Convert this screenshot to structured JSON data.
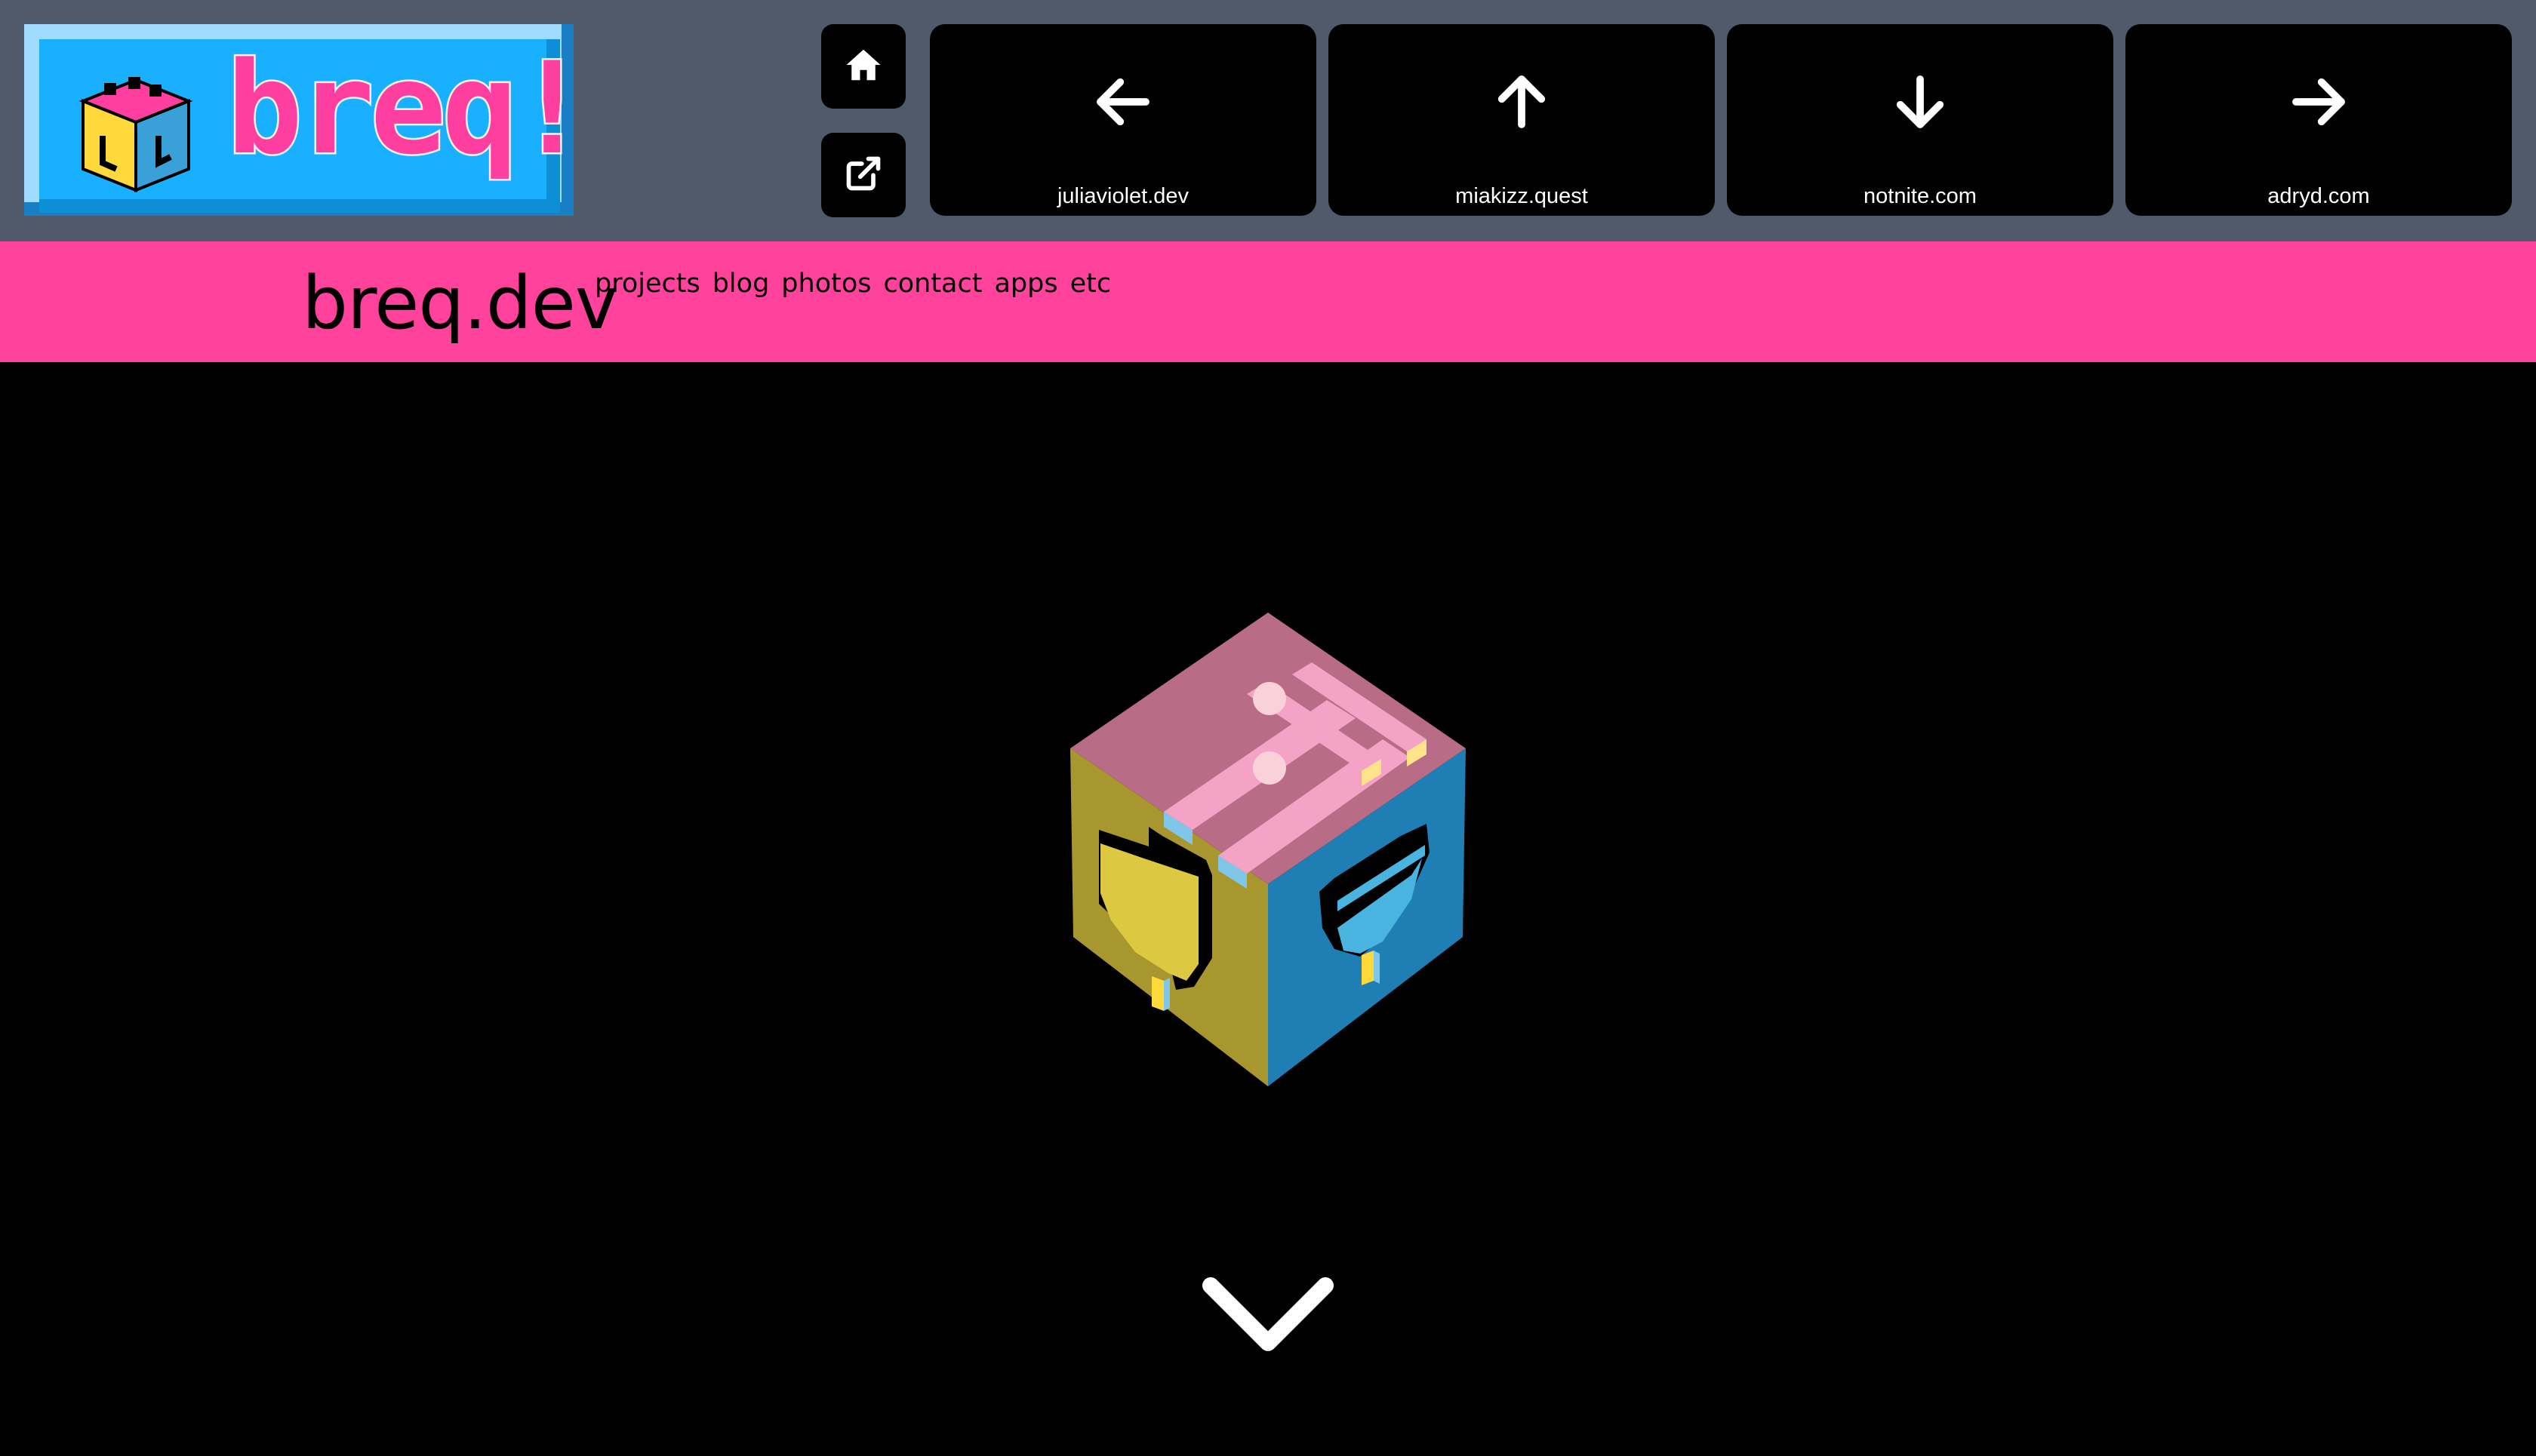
{
  "header": {
    "logo_text": "breq!",
    "home_icon": "home-icon",
    "external_icon": "external-link-icon",
    "webring": [
      {
        "label": "juliaviolet.dev",
        "icon": "arrow-left-icon"
      },
      {
        "label": "miakizz.quest",
        "icon": "arrow-up-icon"
      },
      {
        "label": "notnite.com",
        "icon": "arrow-down-icon"
      },
      {
        "label": "adryd.com",
        "icon": "arrow-right-icon"
      }
    ]
  },
  "nav": {
    "title": "breq.dev",
    "items": [
      "projects",
      "blog",
      "photos",
      "contact",
      "apps",
      "etc"
    ]
  },
  "hero": {
    "scroll_icon": "chevron-down-icon"
  },
  "colors": {
    "topbar": "#4f5a6b",
    "pinkbar": "#ff429c",
    "background": "#000000",
    "cube_top": "#b86c86",
    "cube_left": "#a8962e",
    "cube_right": "#1f7eb4"
  }
}
